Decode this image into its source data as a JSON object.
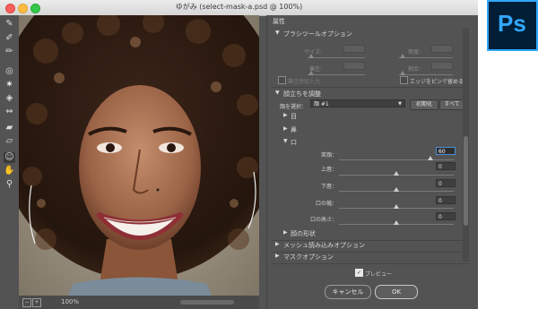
{
  "window": {
    "title": "ゆがみ (select-mask-a.psd @ 100%)"
  },
  "tools": [
    {
      "name": "forward-warp"
    },
    {
      "name": "reconstruct"
    },
    {
      "name": "smooth"
    },
    {
      "name": "twirl"
    },
    {
      "name": "pucker"
    },
    {
      "name": "bloat"
    },
    {
      "name": "push-left"
    },
    {
      "name": "freeze-mask"
    },
    {
      "name": "thaw-mask"
    },
    {
      "name": "face-tool"
    },
    {
      "name": "hand"
    },
    {
      "name": "zoom"
    }
  ],
  "status": {
    "zoom": "100%",
    "zoom_out": "−",
    "zoom_in": "+"
  },
  "panel": {
    "title": "属性",
    "brush_options": {
      "header": "ブラシツールオプション",
      "size_label": "サイズ：",
      "density_label": "密度：",
      "pressure_label": "筆圧：",
      "rate_label": "割合：",
      "size_value": "",
      "density_value": "",
      "pressure_value": "",
      "rate_value": "",
      "stylus_label": "筆圧感知入力",
      "stylus_checked": false,
      "pin_edges_label": "エッジをピンで留める",
      "pin_edges_checked": false
    },
    "face_aware": {
      "header": "顔立ちを調整",
      "select_face_label": "顔を選択：",
      "select_face_value": "顔 #1",
      "reset_button": "初期化",
      "all_button": "すべて",
      "eyes": "目",
      "nose": "鼻",
      "mouth": "口",
      "smile_label": "笑顔：",
      "smile_value": "60",
      "smile_level": 0.8,
      "upper_lip_label": "上唇：",
      "upper_lip_value": "0",
      "lower_lip_label": "下唇：",
      "lower_lip_value": "0",
      "mouth_width_label": "口の幅：",
      "mouth_width_value": "0",
      "mouth_height_label": "口の高さ：",
      "mouth_height_value": "0",
      "face_shape": "顔の形状"
    },
    "load_mesh": "メッシュ読み込みオプション",
    "mask_options": "マスクオプション",
    "preview_label": "プレビュー",
    "preview_checked": true,
    "cancel_button": "キャンセル",
    "ok_button": "OK"
  },
  "app_logo": {
    "text": "Ps",
    "color": "#31a8ff",
    "background": "#001e36"
  }
}
